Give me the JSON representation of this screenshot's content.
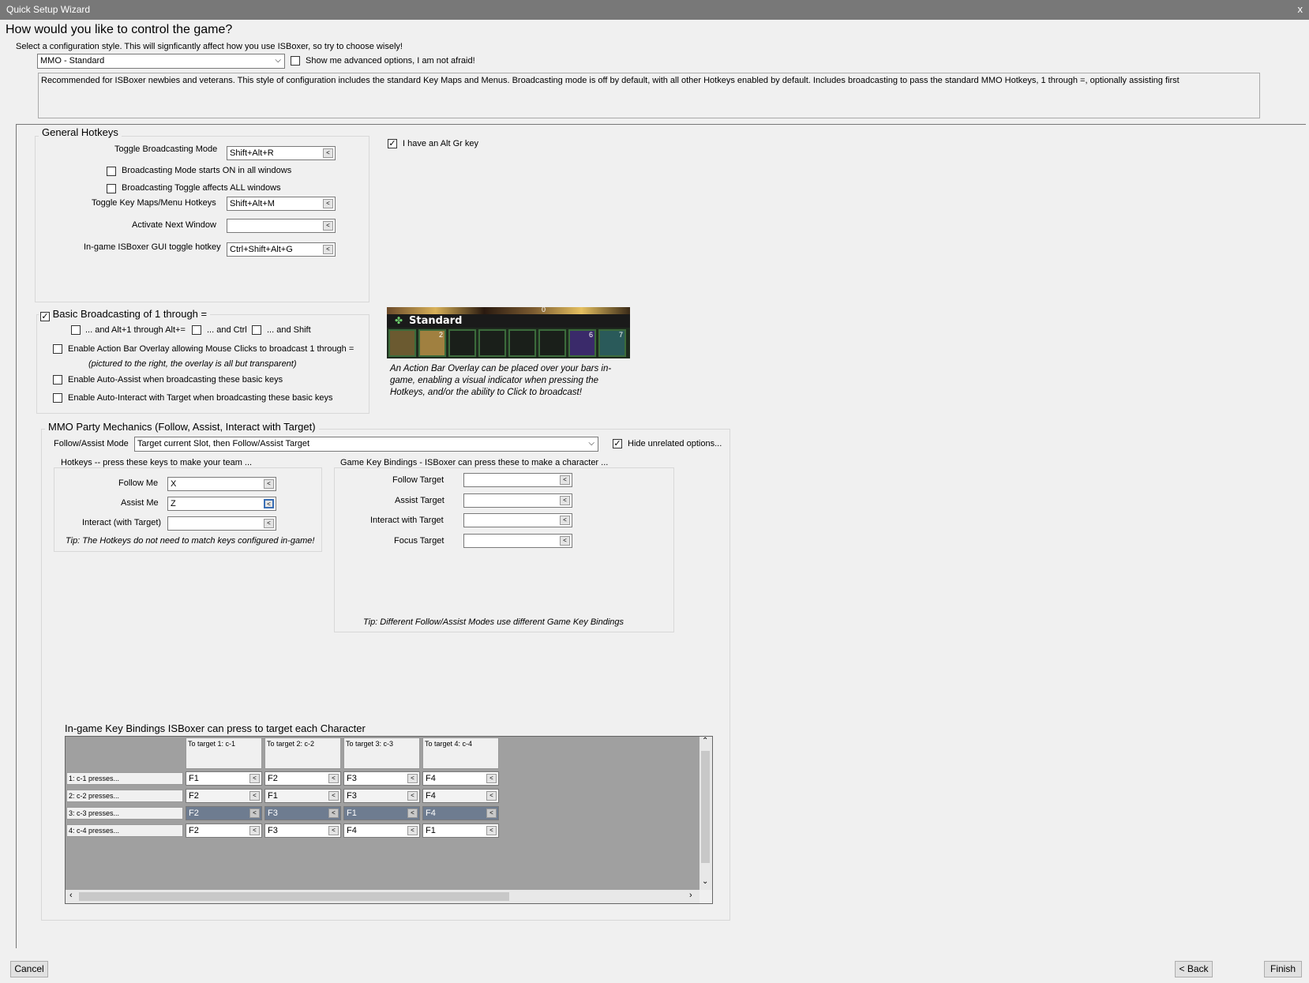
{
  "window": {
    "title": "Quick Setup Wizard",
    "close_label": "x"
  },
  "header": {
    "question": "How would you like to control the game?",
    "instruction": "Select a configuration style. This will signficantly affect how you use ISBoxer, so try to choose wisely!",
    "style_value": "MMO - Standard",
    "advanced_label": "Show me advanced options, I am not afraid!",
    "description": "Recommended for ISBoxer newbies and veterans. This style of configuration includes the standard Key Maps and Menus. Broadcasting mode is off by default, with all other Hotkeys enabled by default. Includes broadcasting to pass the standard MMO Hotkeys, 1 through =, optionally assisting first"
  },
  "general": {
    "title": "General Hotkeys",
    "toggle_broadcast_label": "Toggle Broadcasting Mode",
    "toggle_broadcast_value": "Shift+Alt+R",
    "starts_on_label": "Broadcasting Mode starts ON in all windows",
    "affects_all_label": "Broadcasting Toggle affects ALL windows",
    "toggle_keymaps_label": "Toggle Key Maps/Menu Hotkeys",
    "toggle_keymaps_value": "Shift+Alt+M",
    "activate_next_label": "Activate Next Window",
    "activate_next_value": "",
    "gui_toggle_label": "In-game ISBoxer GUI toggle hotkey",
    "gui_toggle_value": "Ctrl+Shift+Alt+G",
    "altgr_label": "I have an Alt Gr key"
  },
  "basic": {
    "title": "Basic Broadcasting of 1 through =",
    "alt_label": "... and Alt+1 through Alt+=",
    "ctrl_label": "... and Ctrl",
    "shift_label": "... and Shift",
    "overlay_label": "Enable Action Bar Overlay allowing Mouse Clicks to broadcast 1 through =",
    "overlay_note": "(pictured to the right, the overlay is all but transparent)",
    "autoassist_label": "Enable Auto-Assist when broadcasting these basic keys",
    "autointeract_label": "Enable Auto-Interact with Target when broadcasting these basic keys"
  },
  "actionbar": {
    "label": "Standard",
    "slot_numbers": [
      "",
      "2",
      "",
      "",
      "",
      "",
      "6",
      "7"
    ],
    "top_number": "0",
    "caption": "An Action Bar Overlay can be placed over your bars in-game, enabling a visual indicator when pressing the Hotkeys, and/or the ability to Click to broadcast!"
  },
  "party": {
    "title": "MMO Party Mechanics (Follow, Assist, Interact with Target)",
    "mode_label": "Follow/Assist Mode",
    "mode_value": "Target current Slot, then Follow/Assist Target",
    "hide_label": "Hide unrelated options...",
    "hotkeys_title": "Hotkeys -- press these keys to make your team ...",
    "follow_label": "Follow Me",
    "follow_value": "X",
    "assist_label": "Assist Me",
    "assist_value": "Z",
    "interact_label": "Interact (with Target)",
    "interact_value": "",
    "hotkeys_tip": "Tip: The Hotkeys do not need to match keys configured in-game!",
    "bindings_title": "Game Key Bindings - ISBoxer can press these to make a character ...",
    "follow_target_label": "Follow Target",
    "assist_target_label": "Assist Target",
    "interact_target_label": "Interact with Target",
    "focus_target_label": "Focus Target",
    "bindings_tip": "Tip: Different Follow/Assist Modes use different Game Key Bindings"
  },
  "targets": {
    "title": "In-game Key Bindings ISBoxer can press to target each Character",
    "columns": [
      "To target 1: c-1",
      "To target 2: c-2",
      "To target 3: c-3",
      "To target 4: c-4"
    ],
    "rows": [
      {
        "label": "1: c-1 presses...",
        "keys": [
          "F1",
          "F2",
          "F3",
          "F4"
        ],
        "style": "normal"
      },
      {
        "label": "2: c-2 presses...",
        "keys": [
          "F2",
          "F1",
          "F3",
          "F4"
        ],
        "style": "dim"
      },
      {
        "label": "3: c-3 presses...",
        "keys": [
          "F2",
          "F3",
          "F1",
          "F4"
        ],
        "style": "dark"
      },
      {
        "label": "4: c-4 presses...",
        "keys": [
          "F2",
          "F3",
          "F4",
          "F1"
        ],
        "style": "normal"
      }
    ],
    "button_glyph": "<"
  },
  "footer": {
    "cancel": "Cancel",
    "back": "< Back",
    "finish": "Finish"
  }
}
